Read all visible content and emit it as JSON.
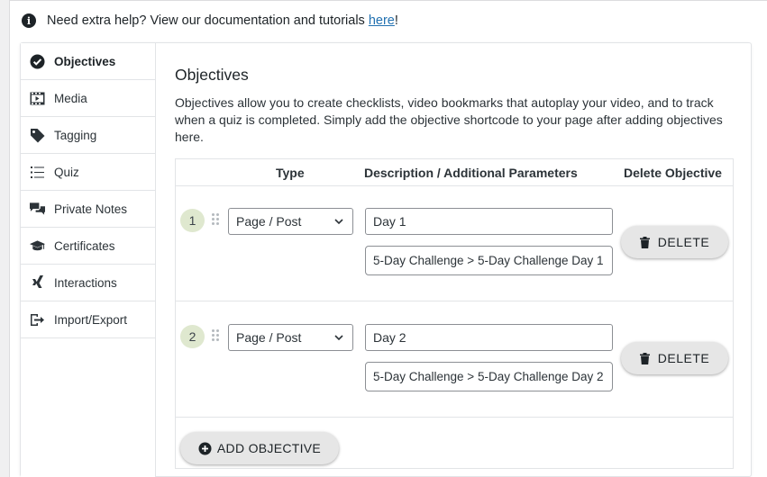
{
  "help": {
    "prefix": "Need extra help? View our documentation and tutorials ",
    "link": "here",
    "suffix": "!"
  },
  "sidebar": {
    "items": [
      {
        "label": "Objectives",
        "icon": "check-circle-icon",
        "active": true
      },
      {
        "label": "Media",
        "icon": "film-icon"
      },
      {
        "label": "Tagging",
        "icon": "tag-icon"
      },
      {
        "label": "Quiz",
        "icon": "list-icon"
      },
      {
        "label": "Private Notes",
        "icon": "chat-bubbles-icon"
      },
      {
        "label": "Certificates",
        "icon": "graduation-cap-icon"
      },
      {
        "label": "Interactions",
        "icon": "xing-icon"
      },
      {
        "label": "Import/Export",
        "icon": "export-icon"
      }
    ]
  },
  "main": {
    "title": "Objectives",
    "description": "Objectives allow you to create checklists, video bookmarks that autoplay your video, and to track when a quiz is completed. Simply add the objective shortcode to your page after adding objectives here.",
    "table": {
      "headers": {
        "type": "Type",
        "description": "Description / Additional Parameters",
        "delete": "Delete Objective"
      },
      "rows": [
        {
          "number": "1",
          "type": "Page / Post",
          "description": "Day 1",
          "parameter": "5-Day Challenge > 5-Day Challenge Day 1",
          "delete_label": "DELETE"
        },
        {
          "number": "2",
          "type": "Page / Post",
          "description": "Day 2",
          "parameter": "5-Day Challenge > 5-Day Challenge Day 2",
          "delete_label": "DELETE"
        }
      ]
    },
    "add_label": "ADD OBJECTIVE"
  },
  "colors": {
    "number_badge": "#dfe8cf",
    "button_bg": "#e6e6e6",
    "link": "#2271b1"
  }
}
